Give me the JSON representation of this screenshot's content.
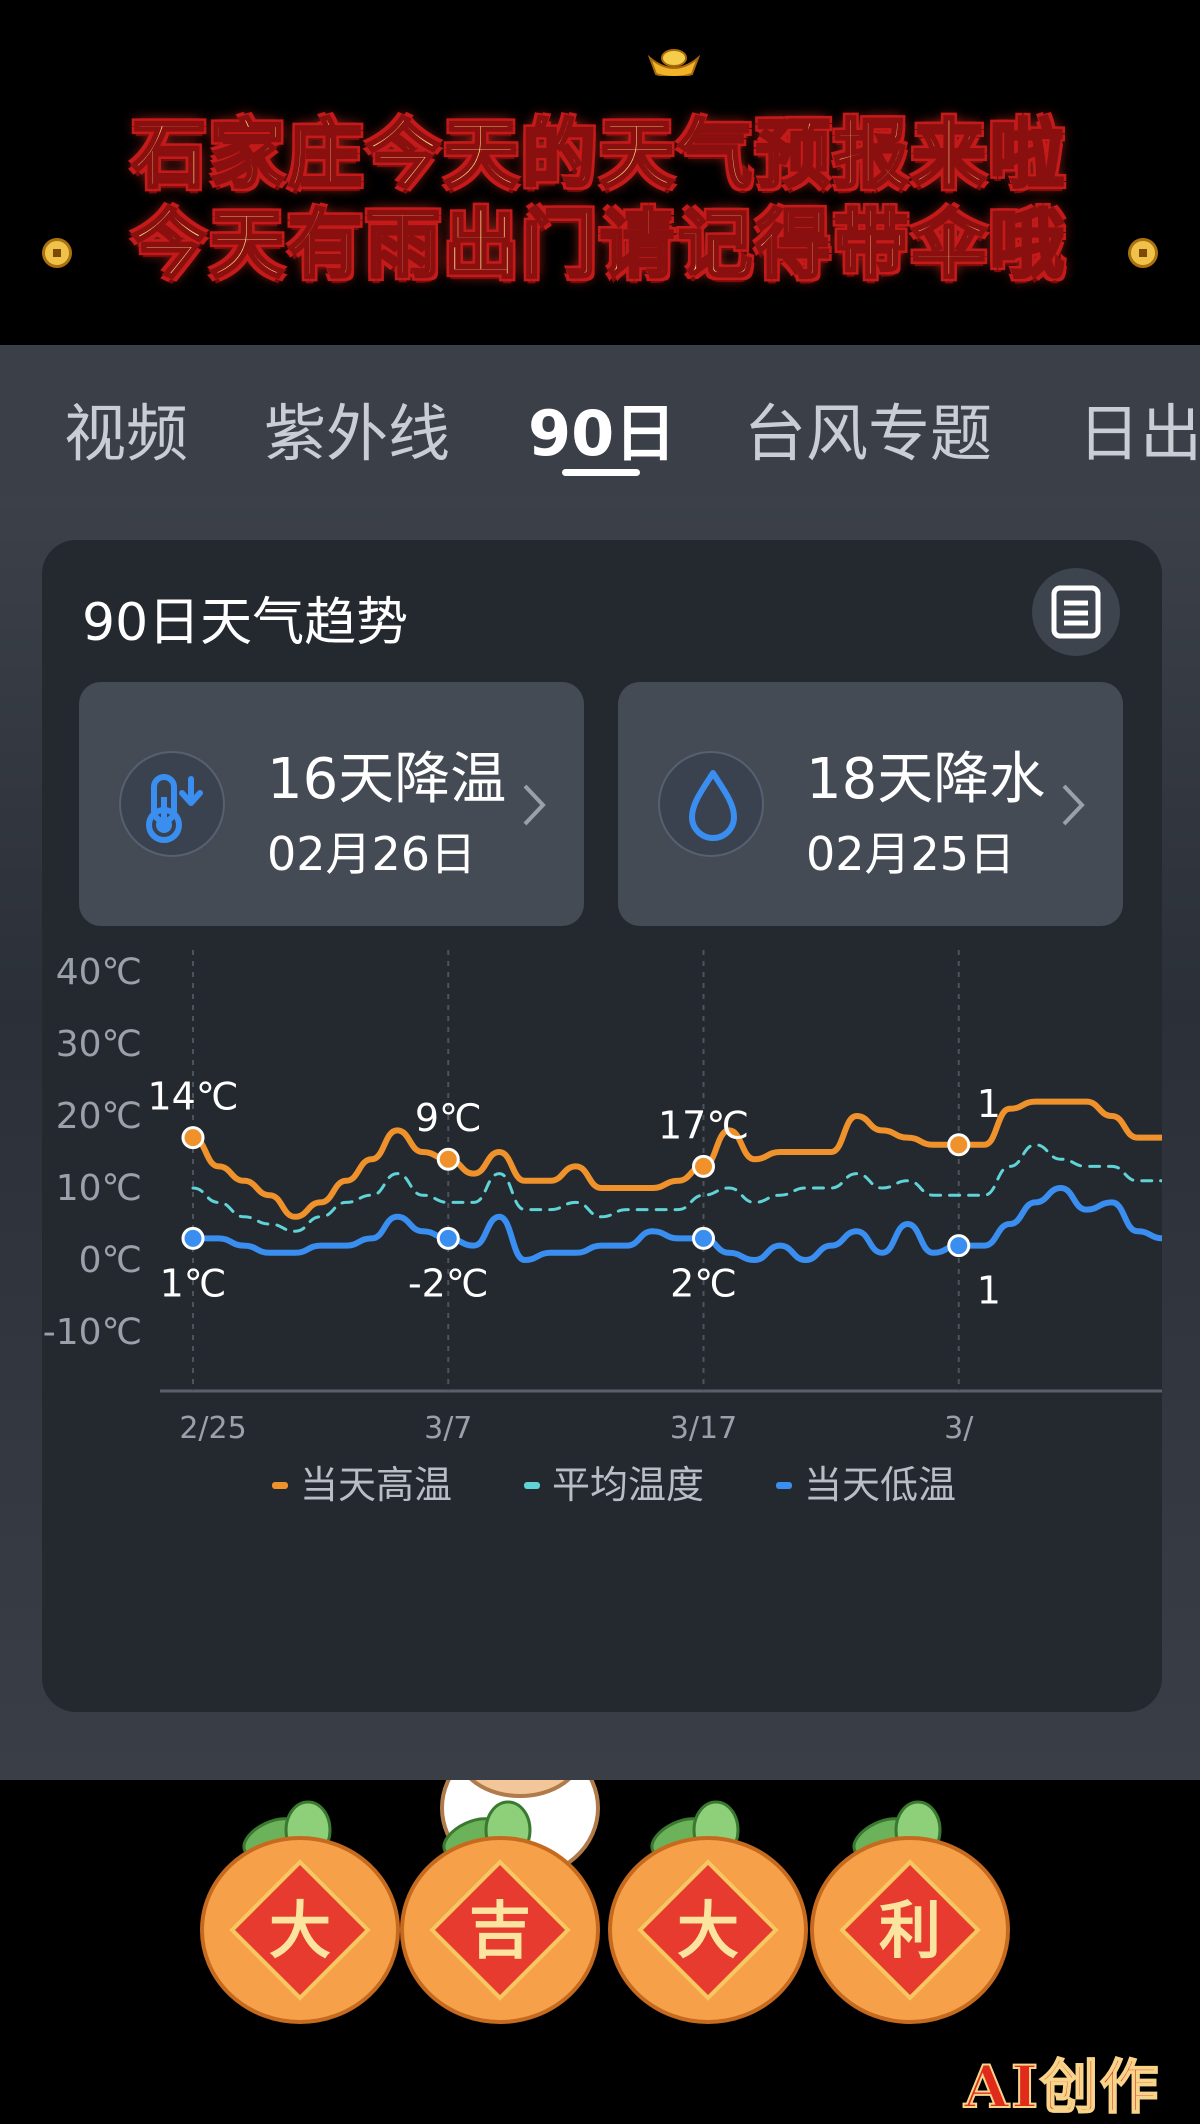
{
  "banner": {
    "line1": "石家庄今天的天气预报来啦",
    "line2": "今天有雨出门请记得带伞哦"
  },
  "tabs": [
    {
      "label": "视频"
    },
    {
      "label": "紫外线"
    },
    {
      "label": "90日"
    },
    {
      "label": "台风专题"
    },
    {
      "label": "日出"
    }
  ],
  "card": {
    "title": "90日天气趋势",
    "menu_icon": "list-icon",
    "stats": [
      {
        "title": "16天降温",
        "date": "02月26日",
        "icon": "thermometer-down-icon"
      },
      {
        "title": "18天降水",
        "date": "02月25日",
        "icon": "water-drop-icon"
      }
    ]
  },
  "chart_data": {
    "type": "line",
    "x_ticks": [
      "2/25",
      "3/7",
      "3/17",
      "3/"
    ],
    "y_ticks": [
      "40℃",
      "30℃",
      "20℃",
      "10℃",
      "0℃",
      "-10℃"
    ],
    "ylim": [
      -10,
      40
    ],
    "series": [
      {
        "name": "当天高温",
        "color": "#f0922c",
        "values": [
          17,
          13,
          11,
          9,
          6,
          8,
          11,
          14,
          18,
          15,
          14,
          12,
          15,
          11,
          11,
          13,
          10,
          10,
          10,
          11,
          13,
          18,
          14,
          15,
          15,
          15,
          20,
          18,
          17,
          16,
          16,
          16,
          21,
          22,
          22,
          22,
          20,
          17,
          17
        ]
      },
      {
        "name": "平均温度",
        "color": "#5fd3d6",
        "values": [
          10,
          8,
          6,
          5,
          4,
          6,
          8,
          9,
          12,
          9,
          8,
          8,
          12,
          7,
          7,
          8,
          6,
          7,
          7,
          7,
          9,
          10,
          8,
          9,
          10,
          10,
          12,
          10,
          11,
          9,
          9,
          9,
          13,
          16,
          14,
          13,
          13,
          11,
          11
        ]
      },
      {
        "name": "当天低温",
        "color": "#3a8ef0",
        "values": [
          3,
          3,
          2,
          1,
          1,
          2,
          2,
          3,
          6,
          4,
          3,
          2,
          6,
          0,
          1,
          1,
          2,
          2,
          4,
          3,
          3,
          1,
          0,
          2,
          0,
          2,
          4,
          1,
          5,
          1,
          2,
          2,
          5,
          8,
          10,
          7,
          8,
          4,
          3
        ]
      }
    ],
    "annotations": [
      {
        "label": "14℃",
        "series": 0,
        "index": 0
      },
      {
        "label": "1℃",
        "series": 2,
        "index": 0
      },
      {
        "label": "9℃",
        "series": 0,
        "index": 10
      },
      {
        "label": "-2℃",
        "series": 2,
        "index": 10
      },
      {
        "label": "17℃",
        "series": 0,
        "index": 20
      },
      {
        "label": "2℃",
        "series": 2,
        "index": 20
      },
      {
        "label": "1",
        "series": 0,
        "index": 30
      },
      {
        "label": "1",
        "series": 2,
        "index": 30
      }
    ],
    "legend": [
      "当天高温",
      "平均温度",
      "当天低温"
    ],
    "legend_position": "bottom",
    "grid": false
  },
  "bottom": {
    "fruit_chars": [
      "大",
      "吉",
      "大",
      "利"
    ],
    "watermark": "AI创作"
  }
}
